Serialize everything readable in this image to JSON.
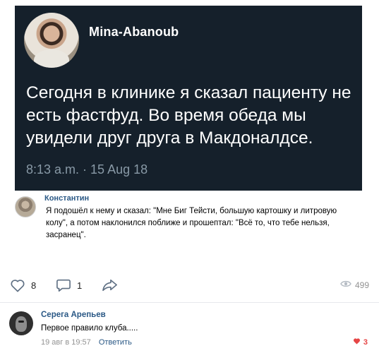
{
  "tweet": {
    "username": "Mina-Abanoub",
    "text": "Сегодня в клинике я сказал пациенту не есть фастфуд. Во время обеда мы увидели друг друга в Макдоналдсе.",
    "timestamp": "8:13 a.m. · 15 Aug 18"
  },
  "repost": {
    "author": "Константин",
    "text": "Я подошёл к нему и сказал: \"Мне Биг Тейсти, большую картошку и литровую колу\", а потом наклонился поближе и прошептал: \"Всё то, что тебе нельзя, засранец\"."
  },
  "actions": {
    "likes": "8",
    "comments": "1",
    "views": "499",
    "icons": [
      "heart-icon",
      "comment-icon",
      "share-icon",
      "eye-icon"
    ]
  },
  "comment": {
    "author": "Серега Арепьев",
    "text": "Первое правило клуба.....",
    "date": "19 авг в 19:57",
    "reply_label": "Ответить",
    "likes": "3"
  },
  "colors": {
    "tweet_bg": "#15202b",
    "link": "#2a5885",
    "like_red": "#e64646",
    "muted": "#939393"
  }
}
